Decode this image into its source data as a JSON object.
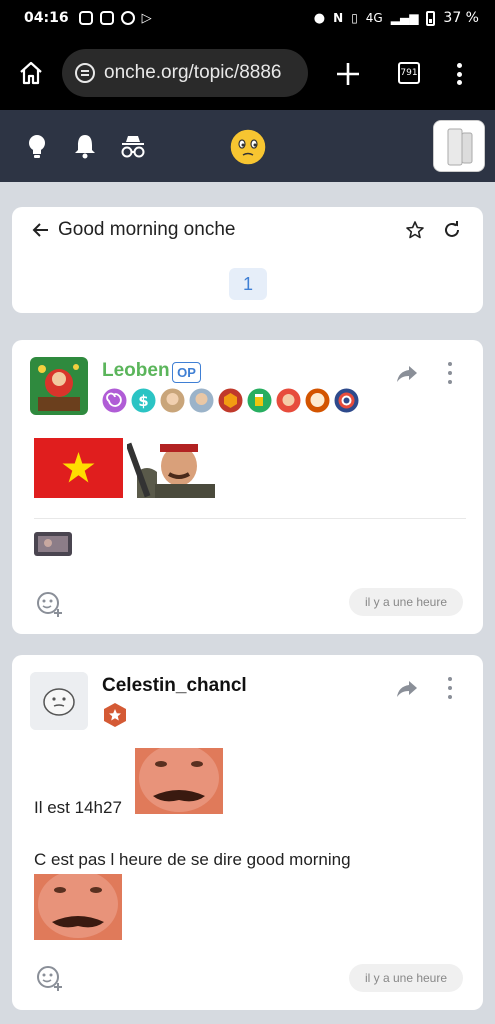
{
  "status_bar": {
    "time": "04:16",
    "network": "4G",
    "battery": "37 %"
  },
  "browser": {
    "url": "onche.org/topic/8886",
    "tab_count": "791"
  },
  "topic": {
    "title": "Good morning onche",
    "current_page": "1"
  },
  "posts": [
    {
      "author": "Leoben",
      "author_color": "#5bb55b",
      "op_label": "OP",
      "timestamp": "il y a une heure"
    },
    {
      "author": "Celestin_chancl",
      "author_color": "#111111",
      "line1": "Il est 14h27",
      "line2": "C est pas l heure de se dire good morning",
      "timestamp": "il y a une heure"
    }
  ]
}
